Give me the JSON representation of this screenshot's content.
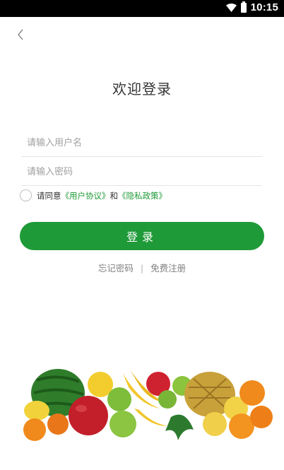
{
  "status_bar": {
    "time": "10:15"
  },
  "title": "欢迎登录",
  "form": {
    "username_placeholder": "请输入用户名",
    "password_placeholder": "请输入密码"
  },
  "agreement": {
    "prefix": "请同意",
    "user_agreement": "《用户协议》",
    "conjunction": "和",
    "privacy_policy": "《隐私政策》"
  },
  "login_button_label": "登录",
  "links": {
    "forgot_password": "忘记密码",
    "separator": "|",
    "register": "免费注册"
  },
  "colors": {
    "accent": "#1f9a38",
    "status_bar": "#000000"
  },
  "icons": {
    "back": "chevron-left-icon",
    "wifi": "wifi-icon",
    "battery": "battery-icon"
  }
}
